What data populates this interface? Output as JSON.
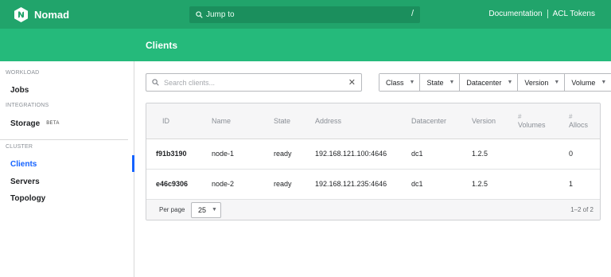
{
  "topbar": {
    "brand": "Nomad",
    "jump_label": "Jump to",
    "jump_shortcut": "/",
    "links": [
      "Documentation",
      "ACL Tokens"
    ]
  },
  "header": {
    "title": "Clients"
  },
  "sidebar": {
    "workload_label": "WORKLOAD",
    "jobs": "Jobs",
    "integrations_label": "INTEGRATIONS",
    "storage": "Storage",
    "storage_badge": "BETA",
    "cluster_label": "CLUSTER",
    "clients": "Clients",
    "servers": "Servers",
    "topology": "Topology"
  },
  "search": {
    "placeholder": "Search clients...",
    "value": ""
  },
  "filters": [
    "Class",
    "State",
    "Datacenter",
    "Version",
    "Volume"
  ],
  "table": {
    "columns": {
      "id": "ID",
      "name": "Name",
      "state": "State",
      "address": "Address",
      "datacenter": "Datacenter",
      "version": "Version",
      "volumes_hash": "#",
      "volumes": "Volumes",
      "allocs_hash": "#",
      "allocs": "Allocs"
    },
    "rows": [
      {
        "id": "f91b3190",
        "name": "node-1",
        "state": "ready",
        "address": "192.168.121.100:4646",
        "datacenter": "dc1",
        "version": "1.2.5",
        "volumes": "",
        "allocs": "0"
      },
      {
        "id": "e46c9306",
        "name": "node-2",
        "state": "ready",
        "address": "192.168.121.235:4646",
        "datacenter": "dc1",
        "version": "1.2.5",
        "volumes": "",
        "allocs": "1"
      }
    ],
    "per_page_label": "Per page",
    "per_page_value": "25",
    "page_info": "1–2 of 2"
  },
  "colors": {
    "topbar": "#21a46b",
    "subheader": "#25ba7b",
    "active": "#1563ff"
  }
}
